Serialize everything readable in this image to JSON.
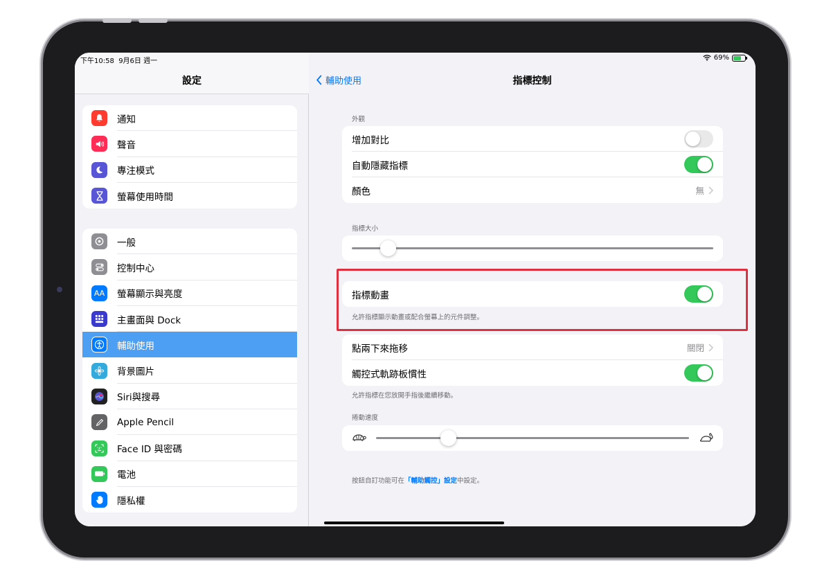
{
  "status": {
    "time": "下午10:58",
    "date": "9月6日 週一",
    "battery": "69%",
    "battery_level": 0.69
  },
  "sidebar": {
    "title": "設定",
    "group1": [
      {
        "label": "通知",
        "icon": "bell-icon",
        "color": "#ff3b30"
      },
      {
        "label": "聲音",
        "icon": "speaker-icon",
        "color": "#ff2d55"
      },
      {
        "label": "專注模式",
        "icon": "moon-icon",
        "color": "#5856d6"
      },
      {
        "label": "螢幕使用時間",
        "icon": "hourglass-icon",
        "color": "#5856d6"
      }
    ],
    "group2": [
      {
        "label": "一般",
        "icon": "gear-icon",
        "color": "#8e8e93"
      },
      {
        "label": "控制中心",
        "icon": "switches-icon",
        "color": "#8e8e93"
      },
      {
        "label": "螢幕顯示與亮度",
        "icon": "text-size-icon",
        "color": "#007aff"
      },
      {
        "label": "主畫面與 Dock",
        "icon": "grid-icon",
        "color": "#3a3acf"
      },
      {
        "label": "輔助使用",
        "icon": "accessibility-icon",
        "color": "#007aff",
        "selected": true
      },
      {
        "label": "背景圖片",
        "icon": "flower-icon",
        "color": "#34aadc"
      },
      {
        "label": "Siri與搜尋",
        "icon": "siri-icon",
        "color": "#222222"
      },
      {
        "label": "Apple Pencil",
        "icon": "pencil-icon",
        "color": "#636366"
      },
      {
        "label": "Face ID 與密碼",
        "icon": "face-id-icon",
        "color": "#34c759"
      },
      {
        "label": "電池",
        "icon": "battery-icon",
        "color": "#34c759"
      },
      {
        "label": "隱私權",
        "icon": "hand-icon",
        "color": "#007aff"
      }
    ]
  },
  "detail": {
    "back_label": "輔助使用",
    "title": "指標控制",
    "appearance": {
      "label": "外觀",
      "increase_contrast": {
        "label": "增加對比",
        "on": false
      },
      "auto_hide": {
        "label": "自動隱藏指標",
        "on": true
      },
      "color": {
        "label": "顏色",
        "value": "無"
      }
    },
    "pointer_size": {
      "label": "指標大小",
      "level": 0.1
    },
    "pointer_animation": {
      "label": "指標動畫",
      "on": true,
      "footnote": "允許指標顯示動畫或配合螢幕上的元件調整。"
    },
    "tap_drag": {
      "label": "點兩下來拖移",
      "value": "關閉"
    },
    "trackpad_inertia": {
      "label": "觸控式軌跡板慣性",
      "on": true,
      "footnote": "允許指標在您放開手指後繼續移動。"
    },
    "scroll_speed": {
      "label": "捲動速度",
      "level": 0.23
    },
    "footer": {
      "prefix": "按鈕自訂功能可在",
      "link": "「輔助觸控」設定",
      "suffix": "中設定。"
    }
  }
}
